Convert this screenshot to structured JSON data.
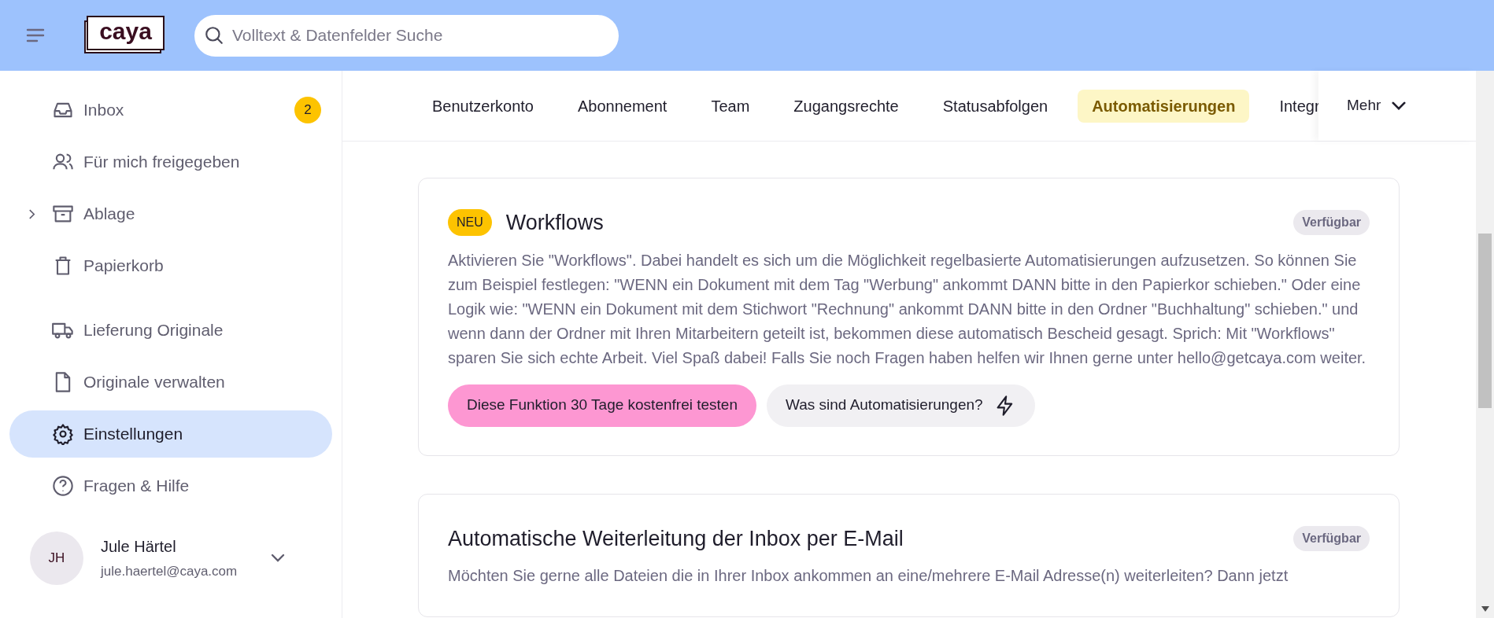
{
  "header": {
    "search": {
      "placeholder": "Volltext & Datenfelder Suche"
    },
    "logo": "caya"
  },
  "sidebar": {
    "groups": [
      {
        "items": [
          {
            "kind": "inbox",
            "label": "Inbox",
            "badge": "2",
            "selected": false
          },
          {
            "kind": "shared",
            "label": "Für mich freigegeben",
            "selected": false
          },
          {
            "kind": "archive",
            "label": "Ablage",
            "selected": false,
            "expanded": false
          },
          {
            "kind": "trash",
            "label": "Papierkorb",
            "selected": false
          }
        ]
      },
      {
        "items": [
          {
            "kind": "truck",
            "label": "Lieferung Originale",
            "selected": false
          },
          {
            "kind": "file",
            "label": "Originale verwalten",
            "selected": false
          },
          {
            "kind": "gear",
            "label": "Einstellungen",
            "selected": true
          },
          {
            "kind": "help",
            "label": "Fragen & Hilfe",
            "selected": false
          }
        ]
      }
    ],
    "user": {
      "initials": "JH",
      "name": "Jule Härtel",
      "email": "jule.haertel@caya.com"
    }
  },
  "tabs": [
    {
      "label": "Benutzerkonto",
      "selected": false
    },
    {
      "label": "Abonnement",
      "selected": false
    },
    {
      "label": "Team",
      "selected": false
    },
    {
      "label": "Zugangsrechte",
      "selected": false
    },
    {
      "label": "Statusabfolgen",
      "selected": false
    },
    {
      "label": "Automatisierungen",
      "selected": true
    },
    {
      "label": "Integr",
      "selected": false
    }
  ],
  "more": "Mehr",
  "cards": [
    {
      "badge": "NEU",
      "title": "Workflows",
      "status": "Verfügbar",
      "text": "Aktivieren Sie \"Workflows\". Dabei handelt es sich um die Möglichkeit regelbasierte Automatisierungen aufzusetzen. So können Sie zum Beispiel festlegen: \"WENN ein Dokument mit dem Tag \"Werbung\" ankommt DANN bitte in den Papierkor schieben.\" Oder eine Logik wie: \"WENN ein Dokument mit dem Stichwort \"Rechnung\" ankommt DANN bitte in den Ordner \"Buchhaltung\" schieben.\" und wenn dann der Ordner mit Ihren Mitarbeitern geteilt ist, bekommen diese automatisch Bescheid gesagt. Sprich: Mit \"Workflows\" sparen Sie sich echte Arbeit. Viel Spaß dabei! Falls Sie noch Fragen haben helfen wir Ihnen gerne unter hello@getcaya.com weiter.",
      "buttons": [
        {
          "kind": "primary",
          "label": "Diese Funktion 30 Tage kostenfrei testen"
        },
        {
          "kind": "secondary",
          "label": "Was sind Automatisierungen?"
        }
      ]
    },
    {
      "title": "Automatische Weiterleitung der Inbox per E-Mail",
      "status": "Verfügbar",
      "text": "Möchten Sie gerne alle Dateien die in Ihrer Inbox ankommen an eine/mehrere E-Mail Adresse(n) weiterleiten? Dann jetzt"
    }
  ]
}
